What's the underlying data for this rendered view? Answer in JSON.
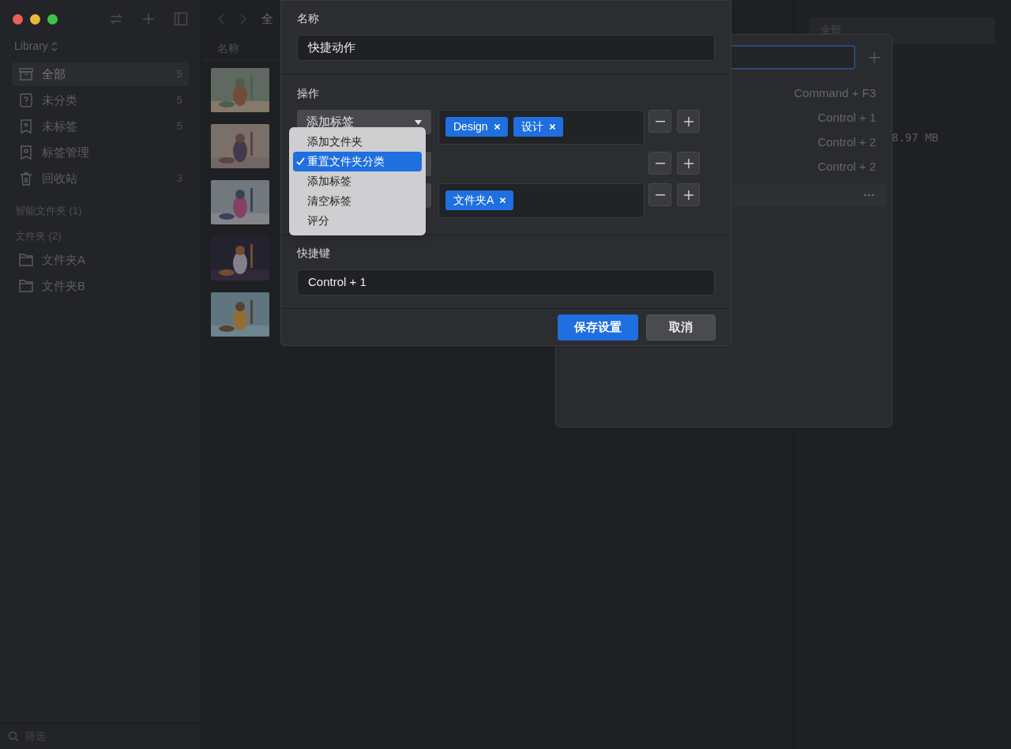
{
  "sidebar": {
    "library": "Library",
    "items": [
      {
        "label": "全部",
        "count": "5",
        "selected": true,
        "kind": "archive"
      },
      {
        "label": "未分类",
        "count": "5",
        "selected": false,
        "kind": "question"
      },
      {
        "label": "未标签",
        "count": "5",
        "selected": false,
        "kind": "untagged"
      },
      {
        "label": "标签管理",
        "selected": false,
        "kind": "tag"
      },
      {
        "label": "回收站",
        "count": "3",
        "selected": false,
        "kind": "trash"
      }
    ],
    "smart_folders": "智能文件夹 (1)",
    "folders_header": "文件夹 (2)",
    "folders": [
      {
        "label": "文件夹A"
      },
      {
        "label": "文件夹B"
      }
    ],
    "filter": {
      "placeholder": "筛选"
    }
  },
  "list": {
    "breadcrumb": "全",
    "column": "名称"
  },
  "inspector": {
    "field": "全部",
    "size": "8.97 MB"
  },
  "shortcut_panel": {
    "shortcuts": [
      "Command + F3",
      "Control + 1",
      "Control + 2",
      "Control + 2"
    ]
  },
  "dialog": {
    "name_label": "名称",
    "name_value": "快捷动作",
    "actions_label": "操作",
    "actions": [
      {
        "kind": "tags",
        "select": "添加标签",
        "tags": [
          "Design",
          "设计"
        ]
      },
      {
        "kind": "empty"
      },
      {
        "kind": "tags",
        "tags": [
          "文件夹A"
        ]
      }
    ],
    "menu": [
      {
        "label": "添加文件夹",
        "selected": false
      },
      {
        "label": "重置文件夹分类",
        "selected": true
      },
      {
        "label": "添加标签",
        "selected": false
      },
      {
        "label": "清空标签",
        "selected": false
      },
      {
        "label": "评分",
        "selected": false
      }
    ],
    "shortcut_label": "快捷键",
    "shortcut_value": "Control + 1",
    "buttons": [
      {
        "label": "保存设置",
        "kind": "primary"
      },
      {
        "label": "取消",
        "kind": "secondary"
      }
    ]
  }
}
